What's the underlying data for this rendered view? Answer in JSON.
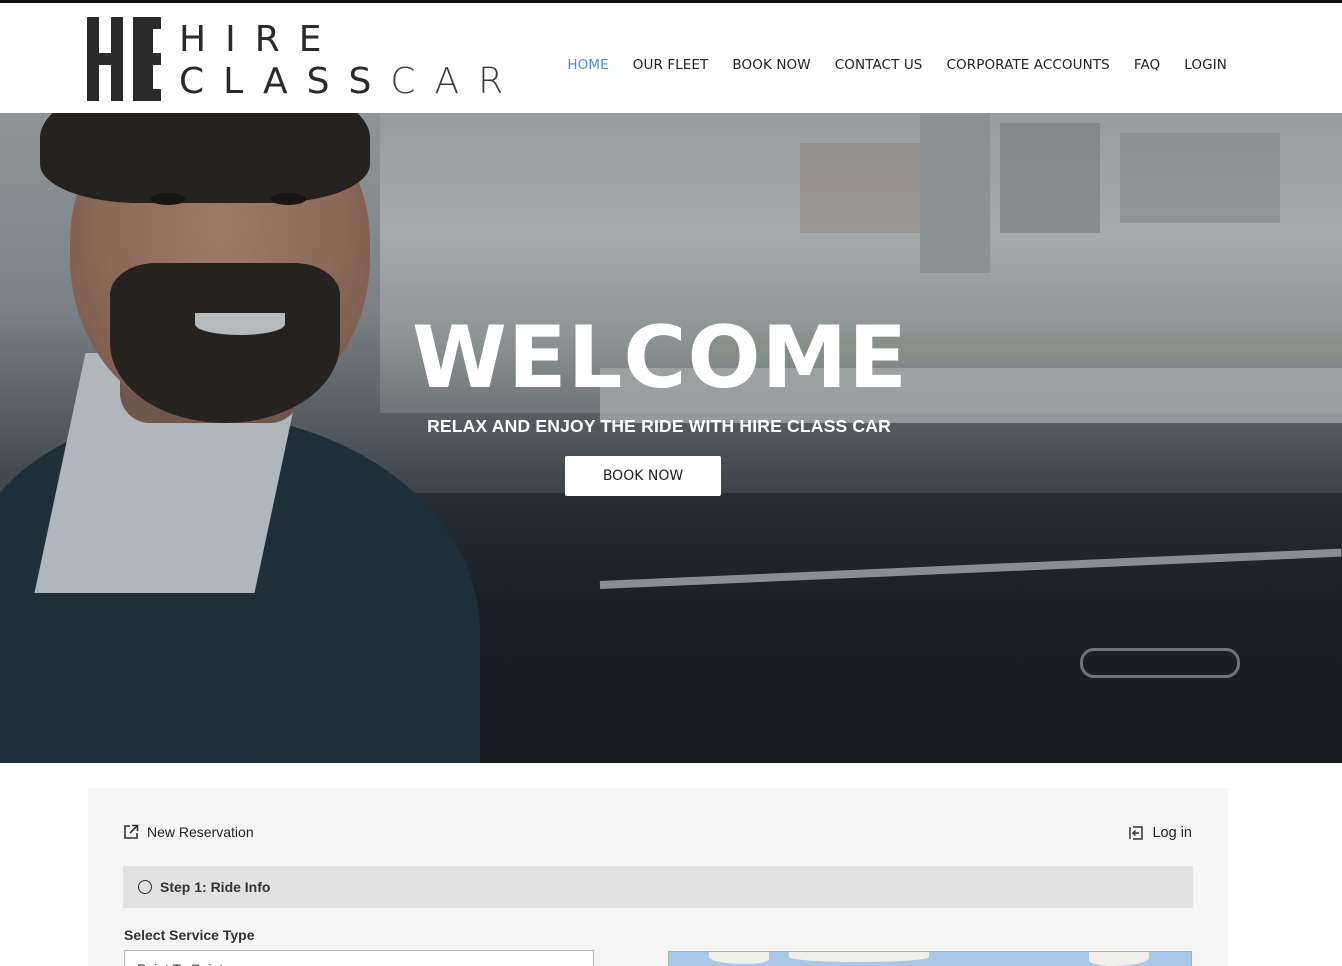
{
  "brand": {
    "logo_line1": "HIRE",
    "logo_line2_a": "CLASS",
    "logo_line2_b": "CAR"
  },
  "nav": {
    "items": [
      {
        "label": "HOME",
        "active": true
      },
      {
        "label": "OUR FLEET",
        "active": false
      },
      {
        "label": "BOOK NOW",
        "active": false
      },
      {
        "label": "CONTACT US",
        "active": false
      },
      {
        "label": "CORPORATE ACCOUNTS",
        "active": false
      },
      {
        "label": "FAQ",
        "active": false
      },
      {
        "label": "LOGIN",
        "active": false
      }
    ],
    "active_color": "#4a90c8"
  },
  "hero": {
    "title": "WELCOME",
    "subtitle": "RELAX AND ENJOY THE RIDE WITH HIRE CLASS CAR",
    "cta_label": "BOOK NOW"
  },
  "reservation": {
    "new_reservation_label": "New Reservation",
    "login_label": "Log in",
    "step_title": "Step 1: Ride Info",
    "service_type_label": "Select Service Type",
    "service_type_value": "Point To Point"
  }
}
